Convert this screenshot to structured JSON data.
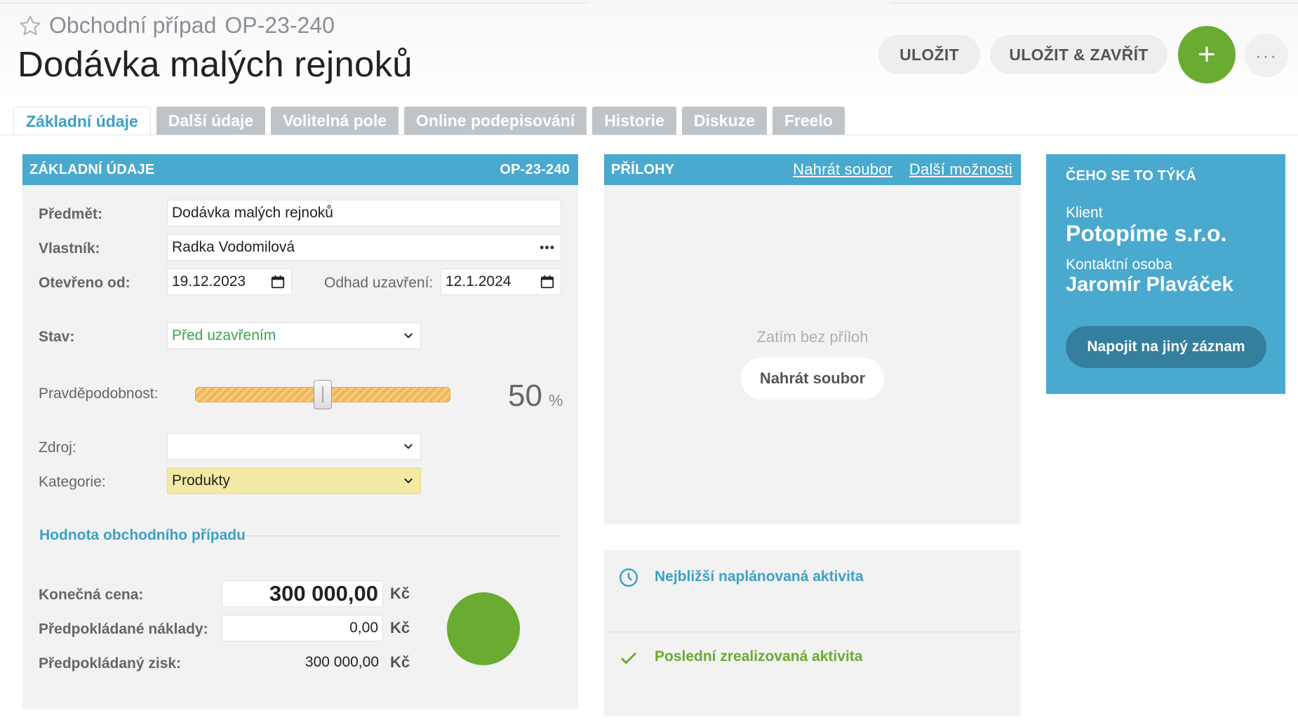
{
  "header": {
    "record_type": "Obchodní případ",
    "record_code": "OP-23-240",
    "title": "Dodávka malých rejnoků",
    "save_label": "ULOŽIT",
    "save_close_label": "ULOŽIT & ZAVŘÍT",
    "add_label": "+",
    "more_label": "···",
    "accent": "#6aab32"
  },
  "tabs": [
    {
      "label": "Základní údaje",
      "active": true
    },
    {
      "label": "Další údaje",
      "active": false
    },
    {
      "label": "Volitelná pole",
      "active": false
    },
    {
      "label": "Online podepisování",
      "active": false
    },
    {
      "label": "Historie",
      "active": false
    },
    {
      "label": "Diskuze",
      "active": false
    },
    {
      "label": "Freelo",
      "active": false
    }
  ],
  "basic": {
    "title": "ZÁKLADNÍ ÚDAJE",
    "code": "OP-23-240",
    "subject_label": "Předmět:",
    "subject_value": "Dodávka malých rejnoků",
    "owner_label": "Vlastník:",
    "owner_value": "Radka Vodomilová",
    "owner_more": "•••",
    "opened_label": "Otevřeno od:",
    "opened_value": "19.12.2023",
    "close_est_label": "Odhad uzavření:",
    "close_est_value": "12.1.2024",
    "status_label": "Stav:",
    "status_value": "Před uzavřením",
    "status_color": "#3fa34d",
    "probability_label": "Pravděpodobnost:",
    "probability_value": "50",
    "probability_fraction": 0.5,
    "probability_unit": "%",
    "source_label": "Zdroj:",
    "source_value": "",
    "category_label": "Kategorie:",
    "category_value": "Produkty",
    "category_bg": "#f4e9a4"
  },
  "value_section": {
    "title": "Hodnota obchodního případu",
    "final_price_label": "Konečná cena:",
    "final_price_value": "300 000,00",
    "costs_label": "Předpokládané náklady:",
    "costs_value": "0,00",
    "profit_label": "Předpokládaný zisk:",
    "profit_value": "300 000,00",
    "currency": "Kč"
  },
  "attachments": {
    "title": "PŘÍLOHY",
    "upload_link": "Nahrát soubor",
    "more_link": "Další možnosti",
    "empty_text": "Zatím bez příloh",
    "upload_button": "Nahrát soubor"
  },
  "activities": {
    "next_label": "Nejbližší naplánovaná aktivita",
    "next_color": "#3ea0c6",
    "last_label": "Poslední zrealizovaná aktivita",
    "last_color": "#6aab32"
  },
  "related": {
    "title": "ČEHO SE TO TÝKÁ",
    "client_label": "Klient",
    "client_value": "Potopíme s.r.o.",
    "contact_label": "Kontaktní osoba",
    "contact_value": "Jaromír Plaváček",
    "connect_button": "Napojit na jiný záznam"
  }
}
